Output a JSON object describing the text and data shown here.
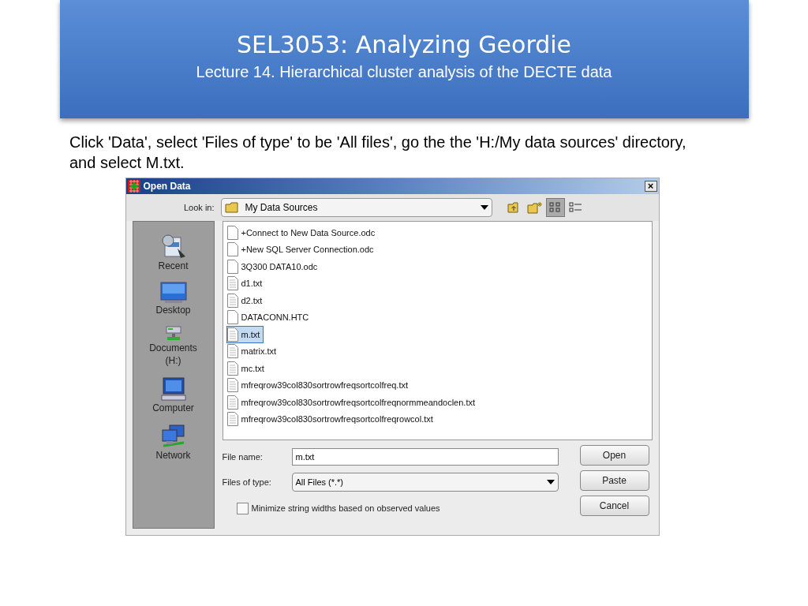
{
  "slide": {
    "title": "SEL3053: Analyzing Geordie",
    "subtitle": "Lecture 14. Hierarchical cluster analysis of the DECTE data",
    "instruction": "Click 'Data', select 'Files of type' to be 'All files', go the the 'H:/My data sources' directory, and select M.txt."
  },
  "dialog": {
    "title": "Open Data",
    "close": "×",
    "look_in": {
      "label": "Look in:",
      "value": "My Data Sources"
    },
    "view_buttons": [
      {
        "kind": "up",
        "selected": false
      },
      {
        "kind": "new-folder",
        "selected": false
      },
      {
        "kind": "list",
        "selected": true
      },
      {
        "kind": "details",
        "selected": false
      }
    ],
    "places": [
      {
        "kind": "recent",
        "label": "Recent"
      },
      {
        "kind": "desktop",
        "label": "Desktop"
      },
      {
        "kind": "documents",
        "label": "Documents (H:)"
      },
      {
        "kind": "computer",
        "label": "Computer"
      },
      {
        "kind": "network",
        "label": "Network"
      }
    ],
    "files": [
      {
        "name": "+Connect to New Data Source.odc",
        "kind": "plain",
        "selected": false
      },
      {
        "name": "+New SQL Server Connection.odc",
        "kind": "plain",
        "selected": false
      },
      {
        "name": "3Q300 DATA10.odc",
        "kind": "plain",
        "selected": false
      },
      {
        "name": "d1.txt",
        "kind": "text",
        "selected": false
      },
      {
        "name": "d2.txt",
        "kind": "text",
        "selected": false
      },
      {
        "name": "DATACONN.HTC",
        "kind": "plain",
        "selected": false
      },
      {
        "name": "m.txt",
        "kind": "text",
        "selected": true
      },
      {
        "name": "matrix.txt",
        "kind": "text",
        "selected": false
      },
      {
        "name": "mc.txt",
        "kind": "text",
        "selected": false
      },
      {
        "name": "mfreqrow39col830sortrowfreqsortcolfreq.txt",
        "kind": "text",
        "selected": false
      },
      {
        "name": "mfreqrow39col830sortrowfreqsortcolfreqnormmeandoclen.txt",
        "kind": "text",
        "selected": false
      },
      {
        "name": "mfreqrow39col830sortrowfreqsortcolfreqrowcol.txt",
        "kind": "text",
        "selected": false
      }
    ],
    "file_name": {
      "label": "File name:",
      "value": "m.txt"
    },
    "file_type": {
      "label": "Files of type:",
      "value": "All Files (*.*)"
    },
    "buttons": [
      "Open",
      "Paste",
      "Cancel"
    ],
    "checkbox": {
      "label": "Minimize string widths based on observed values",
      "checked": false
    }
  }
}
